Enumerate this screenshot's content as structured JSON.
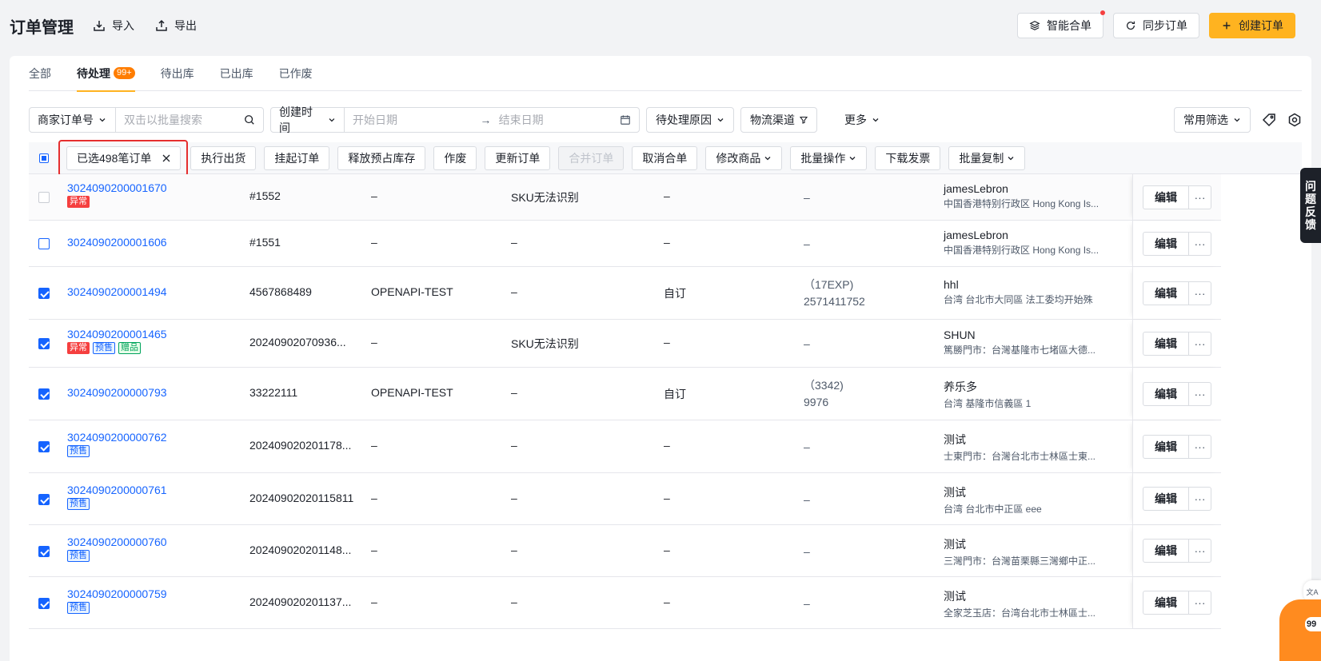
{
  "header": {
    "title": "订单管理",
    "import_label": "导入",
    "export_label": "导出",
    "smart_merge_label": "智能合单",
    "sync_label": "同步订单",
    "create_label": "创建订单"
  },
  "tabs": [
    {
      "label": "全部"
    },
    {
      "label": "待处理",
      "badge": "99+"
    },
    {
      "label": "待出库"
    },
    {
      "label": "已出库"
    },
    {
      "label": "已作废"
    }
  ],
  "filters": {
    "order_field": "商家订单号",
    "search_placeholder": "双击以批量搜索",
    "time_field": "创建时间",
    "start_placeholder": "开始日期",
    "arrow": "→",
    "end_placeholder": "结束日期",
    "reason_label": "待处理原因",
    "logistics_label": "物流渠道",
    "more_label": "更多",
    "common_filter_label": "常用筛选"
  },
  "actions": {
    "selected_label": "已选498笔订单",
    "buttons": [
      "执行出货",
      "挂起订单",
      "释放预占库存",
      "作废",
      "更新订单",
      "合并订单",
      "取消合单",
      "修改商品",
      "批量操作",
      "下载发票",
      "批量复制"
    ]
  },
  "rows": [
    {
      "order_no": "3024090200001670",
      "tags": [
        "异常"
      ],
      "platform_no": "#1552",
      "source": "–",
      "reason": "SKU无法识别",
      "delivery": "–",
      "logistics_1": "–",
      "logistics_2": "",
      "customer": "jamesLebron",
      "address": "中国香港特别行政区 Hong Kong Is...",
      "checked": false
    },
    {
      "order_no": "3024090200001606",
      "tags": [],
      "platform_no": "#1551",
      "source": "–",
      "reason": "–",
      "delivery": "–",
      "logistics_1": "–",
      "logistics_2": "",
      "customer": "jamesLebron",
      "address": "中国香港特别行政区 Hong Kong Is...",
      "checked": false
    },
    {
      "order_no": "3024090200001494",
      "tags": [],
      "platform_no": "4567868489",
      "source": "OPENAPI-TEST",
      "reason": "–",
      "delivery": "自订",
      "logistics_1": "（17EXP)",
      "logistics_2": "2571411752",
      "customer": "hhl",
      "address": "台湾 台北市大同區 法工委均开始殊",
      "checked": true
    },
    {
      "order_no": "3024090200001465",
      "tags": [
        "异常",
        "预售",
        "赠品"
      ],
      "platform_no": "20240902070936...",
      "source": "–",
      "reason": "SKU无法识别",
      "delivery": "–",
      "logistics_1": "–",
      "logistics_2": "",
      "customer": "SHUN",
      "address": "篤勝門市：台灣基隆市七堵區大德...",
      "checked": true
    },
    {
      "order_no": "3024090200000793",
      "tags": [],
      "platform_no": "33222111",
      "source": "OPENAPI-TEST",
      "reason": "–",
      "delivery": "自订",
      "logistics_1": "（3342)",
      "logistics_2": "9976",
      "customer": "养乐多",
      "address": "台湾 基隆市信義區 1",
      "checked": true
    },
    {
      "order_no": "3024090200000762",
      "tags": [
        "预售"
      ],
      "platform_no": "202409020201178...",
      "source": "–",
      "reason": "–",
      "delivery": "–",
      "logistics_1": "–",
      "logistics_2": "",
      "customer": "测试",
      "address": "士東門市：台灣台北市士林區士東...",
      "checked": true
    },
    {
      "order_no": "3024090200000761",
      "tags": [
        "预售"
      ],
      "platform_no": "20240902020115811",
      "source": "–",
      "reason": "–",
      "delivery": "–",
      "logistics_1": "–",
      "logistics_2": "",
      "customer": "测试",
      "address": "台湾 台北市中正區 eee",
      "checked": true
    },
    {
      "order_no": "3024090200000760",
      "tags": [
        "预售"
      ],
      "platform_no": "202409020201148...",
      "source": "–",
      "reason": "–",
      "delivery": "–",
      "logistics_1": "–",
      "logistics_2": "",
      "customer": "测试",
      "address": "三灣門市：台灣苗栗縣三灣鄉中正...",
      "checked": true
    },
    {
      "order_no": "3024090200000759",
      "tags": [
        "预售"
      ],
      "platform_no": "202409020201137...",
      "source": "–",
      "reason": "–",
      "delivery": "–",
      "logistics_1": "–",
      "logistics_2": "",
      "customer": "测试",
      "address": "全家芝玉店：台湾台北市士林區士...",
      "checked": true
    }
  ],
  "row_ops": {
    "edit_label": "编辑",
    "more_label": "···"
  },
  "floating": {
    "feedback": [
      "问",
      "题",
      "反",
      "馈"
    ],
    "translate": "文A",
    "chat_badge": "99"
  },
  "colors": {
    "accent": "#ffb320",
    "link": "#1664ff",
    "danger": "#f53f3f",
    "highlight_box": "#e52e2e"
  },
  "icons": [
    "import-icon",
    "export-icon",
    "layers-icon",
    "sync-icon",
    "plus-icon",
    "search-icon",
    "calendar-icon",
    "filter-icon",
    "tag-icon",
    "settings-icon",
    "close-icon",
    "chevron-down-icon"
  ]
}
